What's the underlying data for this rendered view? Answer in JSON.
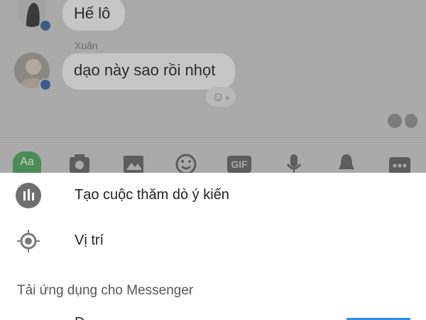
{
  "chat": {
    "messages": [
      {
        "text": "Hế lô"
      },
      {
        "sender": "Xuân",
        "text": "dạo này sao rồi nhọt"
      }
    ],
    "reaction_icon": "add-reaction-icon"
  },
  "toolbar": {
    "aa_label": "Aa",
    "gif_label": "GIF",
    "icons": [
      "text-aa-icon",
      "camera-icon",
      "image-icon",
      "emoji-icon",
      "gif-icon",
      "microphone-icon",
      "bell-icon",
      "more-icon"
    ]
  },
  "sheet": {
    "poll_label": "Tạo cuộc thăm dò ý kiến",
    "location_label": "Vị trí",
    "section_title": "Tải ứng dụng cho Messenger",
    "partial_item": "D"
  },
  "colors": {
    "overlay": "#aaaaaa",
    "bubble": "#c6c6c6",
    "aa_button": "#4b8b56",
    "accent": "#2f8ee5"
  }
}
